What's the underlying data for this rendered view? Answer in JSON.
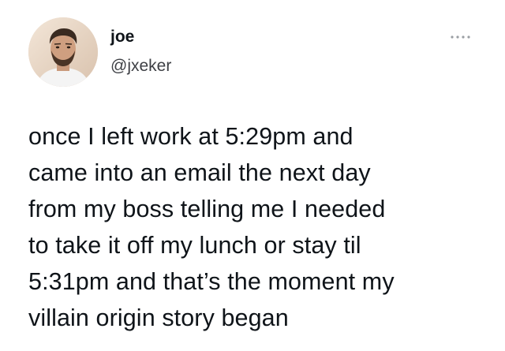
{
  "author": {
    "display_name": "joe",
    "handle": "@jxeker",
    "avatar_icon": "profile-photo"
  },
  "more_icon": "more-options-icon",
  "tweet": {
    "lines": [
      "once I left work at 5:29pm and",
      "came into an email the next day",
      "from my boss telling me I needed",
      "to take it off my lunch or stay til",
      "5:31pm and that’s the moment my",
      "villain origin story began"
    ]
  },
  "colors": {
    "background": "#ffffff",
    "text": "#0f1419",
    "secondary_text": "#3d3f44"
  }
}
